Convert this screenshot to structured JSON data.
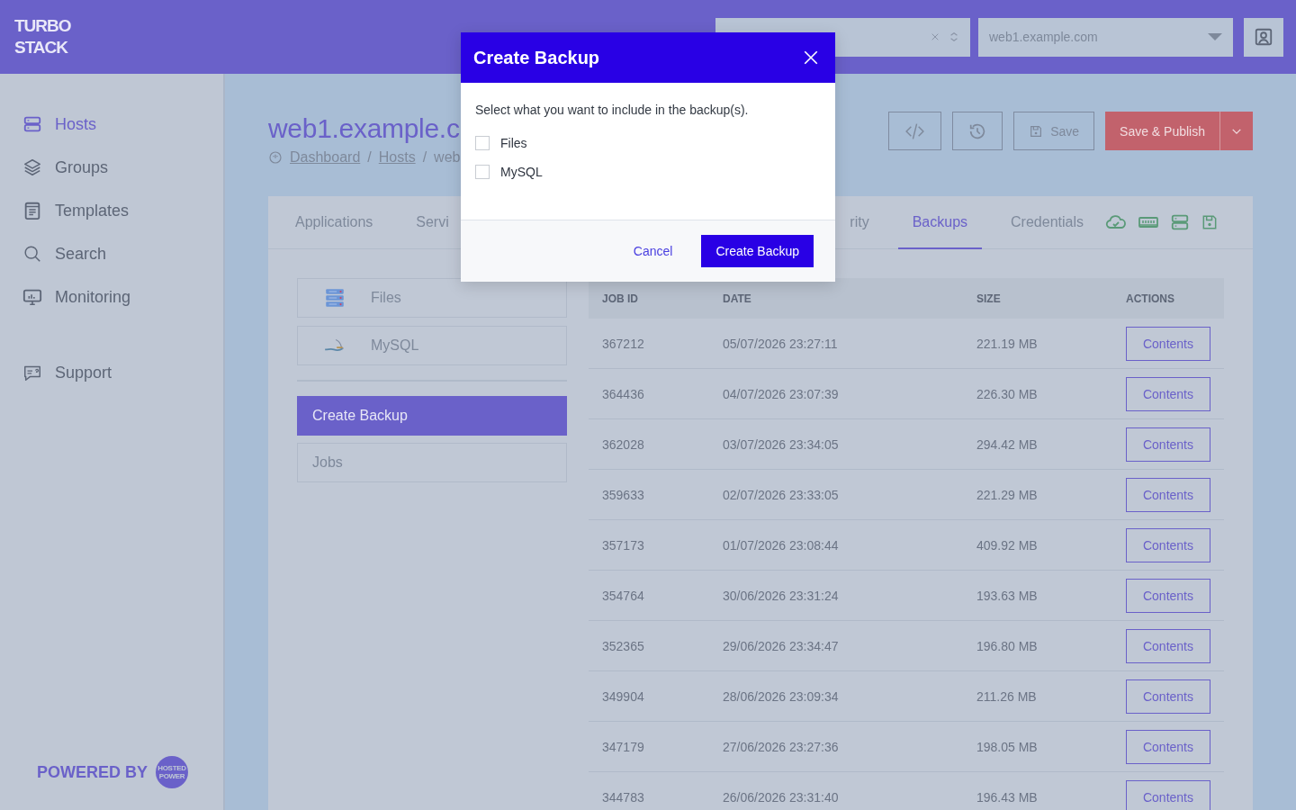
{
  "header": {
    "logo": [
      "TURBO",
      "STACK"
    ],
    "server_select": {
      "value": "web1.example.com"
    }
  },
  "sidebar": {
    "items": [
      {
        "label": "Hosts",
        "kind": "hosts",
        "selected": true
      },
      {
        "label": "Groups",
        "kind": "groups",
        "selected": false
      },
      {
        "label": "Templates",
        "kind": "templates",
        "selected": false
      },
      {
        "label": "Search",
        "kind": "search",
        "selected": false
      },
      {
        "label": "Monitoring",
        "kind": "monitoring",
        "selected": false
      }
    ],
    "secondary_items": [
      {
        "label": "Support",
        "kind": "support",
        "selected": false
      }
    ],
    "powered_by": {
      "label": "POWERED BY",
      "logo": [
        "HOSTED",
        "POWER"
      ]
    }
  },
  "page": {
    "title": "web1.example.c",
    "breadcrumb": [
      {
        "label": "Dashboard",
        "kind": "link"
      },
      {
        "label": "/",
        "kind": "separator"
      },
      {
        "label": "Hosts",
        "kind": "link"
      },
      {
        "label": "/",
        "kind": "separator"
      },
      {
        "label": "web",
        "kind": "current"
      }
    ],
    "toolbar": {
      "save": "Save",
      "publish": "Save & Publish"
    }
  },
  "tabs": [
    {
      "label": "Applications",
      "selected": false
    },
    {
      "label": "Servi",
      "selected": false
    },
    {
      "label": "rity",
      "selected": false
    },
    {
      "label": "Backups",
      "selected": true
    },
    {
      "label": "Credentials",
      "selected": false
    }
  ],
  "backup_types": [
    {
      "label": "Files",
      "kind": "files"
    },
    {
      "label": "MySQL",
      "kind": "mysql"
    }
  ],
  "actions": [
    {
      "label": "Create Backup",
      "selected": true
    },
    {
      "label": "Jobs",
      "selected": false
    }
  ],
  "table": {
    "columns": [
      "JOB ID",
      "DATE",
      "SIZE",
      "ACTIONS"
    ],
    "rows": [
      {
        "job_id": "367212",
        "date": "05/07/2026 23:27:11",
        "size": "221.19 MB",
        "action": "Contents"
      },
      {
        "job_id": "364436",
        "date": "04/07/2026 23:07:39",
        "size": "226.30 MB",
        "action": "Contents"
      },
      {
        "job_id": "362028",
        "date": "03/07/2026 23:34:05",
        "size": "294.42 MB",
        "action": "Contents"
      },
      {
        "job_id": "359633",
        "date": "02/07/2026 23:33:05",
        "size": "221.29 MB",
        "action": "Contents"
      },
      {
        "job_id": "357173",
        "date": "01/07/2026 23:08:44",
        "size": "409.92 MB",
        "action": "Contents"
      },
      {
        "job_id": "354764",
        "date": "30/06/2026 23:31:24",
        "size": "193.63 MB",
        "action": "Contents"
      },
      {
        "job_id": "352365",
        "date": "29/06/2026 23:34:47",
        "size": "196.80 MB",
        "action": "Contents"
      },
      {
        "job_id": "349904",
        "date": "28/06/2026 23:09:34",
        "size": "211.26 MB",
        "action": "Contents"
      },
      {
        "job_id": "347179",
        "date": "27/06/2026 23:27:36",
        "size": "198.05 MB",
        "action": "Contents"
      },
      {
        "job_id": "344783",
        "date": "26/06/2026 23:31:40",
        "size": "196.43 MB",
        "action": "Contents"
      }
    ]
  },
  "modal": {
    "title": "Create Backup",
    "message": "Select what you want to include in the backup(s).",
    "options": [
      {
        "label": "Files",
        "checked": false
      },
      {
        "label": "MySQL",
        "checked": false
      }
    ],
    "cancel": "Cancel",
    "confirm": "Create Backup"
  }
}
